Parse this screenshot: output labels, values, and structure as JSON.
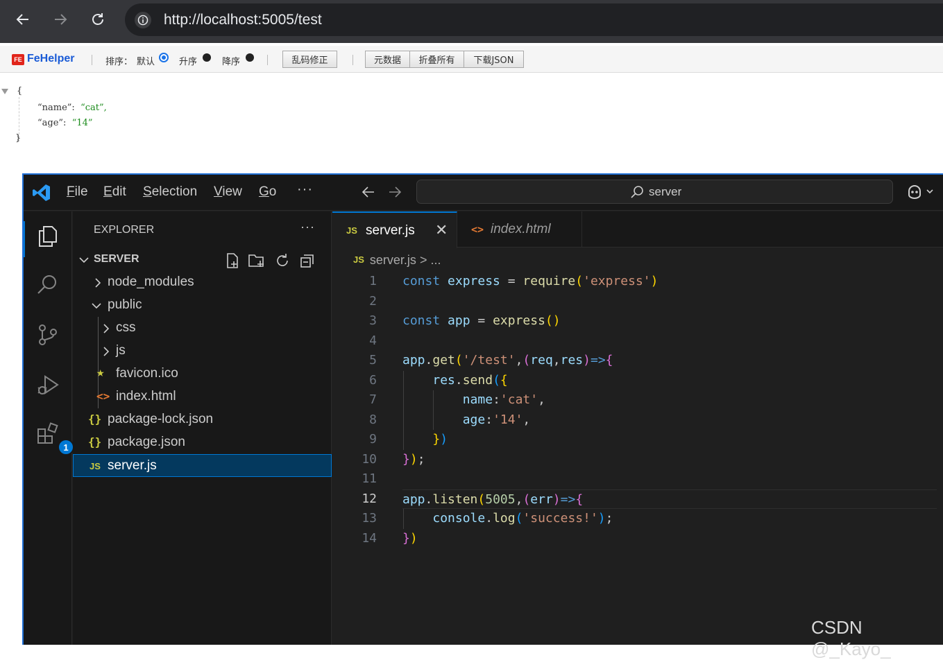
{
  "browser": {
    "url": "http://localhost:5005/test"
  },
  "fehelper": {
    "brand": "FeHelper",
    "logo_text": "FE",
    "sort_label": "排序：",
    "sort_default": "默认",
    "sort_asc": "升序",
    "sort_desc": "降序",
    "fix_encoding": "乱码修正",
    "metadata": "元数据",
    "fold_all": "折叠所有",
    "download_json": "下载JSON",
    "selected_sort": "默认"
  },
  "json_view": {
    "open_brace": "{",
    "close_brace": "}",
    "entries": [
      {
        "key": "“name”:",
        "value": "“cat”,"
      },
      {
        "key": "“age”:",
        "value": "“14”"
      }
    ]
  },
  "vscode": {
    "menu": [
      "File",
      "Edit",
      "Selection",
      "View",
      "Go"
    ],
    "menu_more": "···",
    "command_center": "server",
    "activity_badge": "1",
    "explorer": {
      "title": "EXPLORER",
      "more": "···",
      "section": "SERVER",
      "items": [
        {
          "label": "node_modules",
          "kind": "folder",
          "expanded": false
        },
        {
          "label": "public",
          "kind": "folder",
          "expanded": true
        },
        {
          "label": "css",
          "kind": "folder",
          "expanded": false
        },
        {
          "label": "js",
          "kind": "folder",
          "expanded": false
        },
        {
          "label": "favicon.ico",
          "kind": "star-icon"
        },
        {
          "label": "index.html",
          "kind": "html-icon"
        },
        {
          "label": "package-lock.json",
          "kind": "json-icon"
        },
        {
          "label": "package.json",
          "kind": "json-icon"
        },
        {
          "label": "server.js",
          "kind": "js-icon",
          "selected": true
        }
      ]
    },
    "tabs": [
      {
        "label": "server.js",
        "icon": "JS",
        "active": true,
        "close": "✕"
      },
      {
        "label": "index.html",
        "icon": "<>",
        "active": false
      }
    ],
    "breadcrumb": {
      "icon": "JS",
      "file": "server.js",
      "rest": "> ..."
    },
    "current_line": 12,
    "code_lines": [
      {
        "n": "1",
        "tokens": [
          [
            "kw",
            "const"
          ],
          [
            "p",
            " "
          ],
          [
            "var",
            "express"
          ],
          [
            "p",
            " = "
          ],
          [
            "fn",
            "require"
          ],
          [
            "b1",
            "("
          ],
          [
            "str",
            "'express'"
          ],
          [
            "b1",
            ")"
          ]
        ]
      },
      {
        "n": "2",
        "tokens": []
      },
      {
        "n": "3",
        "tokens": [
          [
            "kw",
            "const"
          ],
          [
            "p",
            " "
          ],
          [
            "var",
            "app"
          ],
          [
            "p",
            " = "
          ],
          [
            "fn",
            "express"
          ],
          [
            "b1",
            "()"
          ]
        ]
      },
      {
        "n": "4",
        "tokens": []
      },
      {
        "n": "5",
        "tokens": [
          [
            "var",
            "app"
          ],
          [
            "p",
            "."
          ],
          [
            "fn",
            "get"
          ],
          [
            "b1",
            "("
          ],
          [
            "str",
            "'/test'"
          ],
          [
            "p",
            ","
          ],
          [
            "b2",
            "("
          ],
          [
            "var",
            "req"
          ],
          [
            "p",
            ","
          ],
          [
            "var",
            "res"
          ],
          [
            "b2",
            ")"
          ],
          [
            "kw",
            "=>"
          ],
          [
            "b2",
            "{"
          ]
        ]
      },
      {
        "n": "6",
        "tokens": [
          [
            "p",
            "    "
          ],
          [
            "var",
            "res"
          ],
          [
            "p",
            "."
          ],
          [
            "fn",
            "send"
          ],
          [
            "b3",
            "("
          ],
          [
            "b1",
            "{"
          ]
        ]
      },
      {
        "n": "7",
        "tokens": [
          [
            "p",
            "        "
          ],
          [
            "var",
            "name"
          ],
          [
            "p",
            ":"
          ],
          [
            "str",
            "'cat'"
          ],
          [
            "p",
            ","
          ]
        ]
      },
      {
        "n": "8",
        "tokens": [
          [
            "p",
            "        "
          ],
          [
            "var",
            "age"
          ],
          [
            "p",
            ":"
          ],
          [
            "str",
            "'14'"
          ],
          [
            "p",
            ","
          ]
        ]
      },
      {
        "n": "9",
        "tokens": [
          [
            "p",
            "    "
          ],
          [
            "b1",
            "}"
          ],
          [
            "b3",
            ")"
          ]
        ]
      },
      {
        "n": "10",
        "tokens": [
          [
            "b2",
            "}"
          ],
          [
            "b1",
            ")"
          ],
          [
            "p",
            ";"
          ]
        ]
      },
      {
        "n": "11",
        "tokens": []
      },
      {
        "n": "12",
        "tokens": [
          [
            "var",
            "app"
          ],
          [
            "p",
            "."
          ],
          [
            "fn",
            "listen"
          ],
          [
            "b1",
            "("
          ],
          [
            "num",
            "5005"
          ],
          [
            "p",
            ","
          ],
          [
            "b2",
            "("
          ],
          [
            "var",
            "err"
          ],
          [
            "b2",
            ")"
          ],
          [
            "kw",
            "=>"
          ],
          [
            "b2",
            "{"
          ]
        ]
      },
      {
        "n": "13",
        "tokens": [
          [
            "p",
            "    "
          ],
          [
            "var",
            "console"
          ],
          [
            "p",
            "."
          ],
          [
            "fn",
            "log"
          ],
          [
            "b3",
            "("
          ],
          [
            "str",
            "'success!'"
          ],
          [
            "b3",
            ")"
          ],
          [
            "p",
            ";"
          ]
        ]
      },
      {
        "n": "14",
        "tokens": [
          [
            "b2",
            "}"
          ],
          [
            "b1",
            ")"
          ]
        ]
      }
    ]
  },
  "watermark": "CSDN @_Kayo_",
  "colors": {
    "accent": "#0078d4",
    "js_icon": "#cbcb41",
    "html_icon": "#e37933",
    "fehelper_brand": "#1a5bd6"
  }
}
